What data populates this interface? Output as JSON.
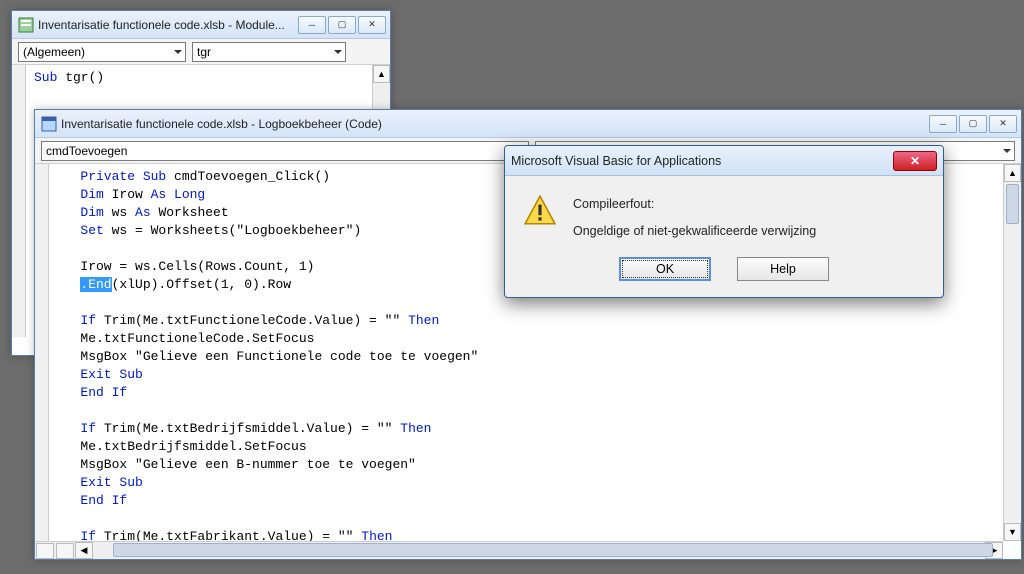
{
  "back_window": {
    "title": "Inventarisatie functionele code.xlsb - Module...",
    "combo_left": "(Algemeen)",
    "combo_right": "tgr",
    "code": "Sub tgr()\n"
  },
  "front_window": {
    "title": "Inventarisatie functionele code.xlsb - Logboekbeheer (Code)",
    "combo_left": "cmdToevoegen",
    "combo_right": "",
    "code": {
      "l1a": "Private Sub",
      "l1b": " cmdToevoegen_Click()",
      "l2a": "Dim",
      "l2b": " Irow ",
      "l2c": "As Long",
      "l3a": "Dim",
      "l3b": " ws ",
      "l3c": "As",
      "l3d": " Worksheet",
      "l4a": "Set",
      "l4b": " ws = Worksheets(\"Logboekbeheer\")",
      "blank": "",
      "l5": "Irow = ws.Cells(Rows.Count, 1)",
      "l6sel": ".End",
      "l6rest": "(xlUp).Offset(1, 0).Row",
      "l7a": "If",
      "l7b": " Trim(Me.txtFunctioneleCode.Value) = \"\" ",
      "l7c": "Then",
      "l8": "Me.txtFunctioneleCode.SetFocus",
      "l9": "MsgBox \"Gelieve een Functionele code toe te voegen\"",
      "l10": "Exit Sub",
      "l11": "End If",
      "l12a": "If",
      "l12b": " Trim(Me.txtBedrijfsmiddel.Value) = \"\" ",
      "l12c": "Then",
      "l13": "Me.txtBedrijfsmiddel.SetFocus",
      "l14": "MsgBox \"Gelieve een B-nummer toe te voegen\"",
      "l15": "Exit Sub",
      "l16": "End If",
      "l17a": "If",
      "l17b": " Trim(Me.txtFabrikant.Value) = \"\" ",
      "l17c": "Then"
    }
  },
  "dialog": {
    "title": "Microsoft Visual Basic for Applications",
    "heading": "Compileerfout:",
    "message": "Ongeldige of niet-gekwalificeerde verwijzing",
    "ok": "OK",
    "help": "Help"
  }
}
